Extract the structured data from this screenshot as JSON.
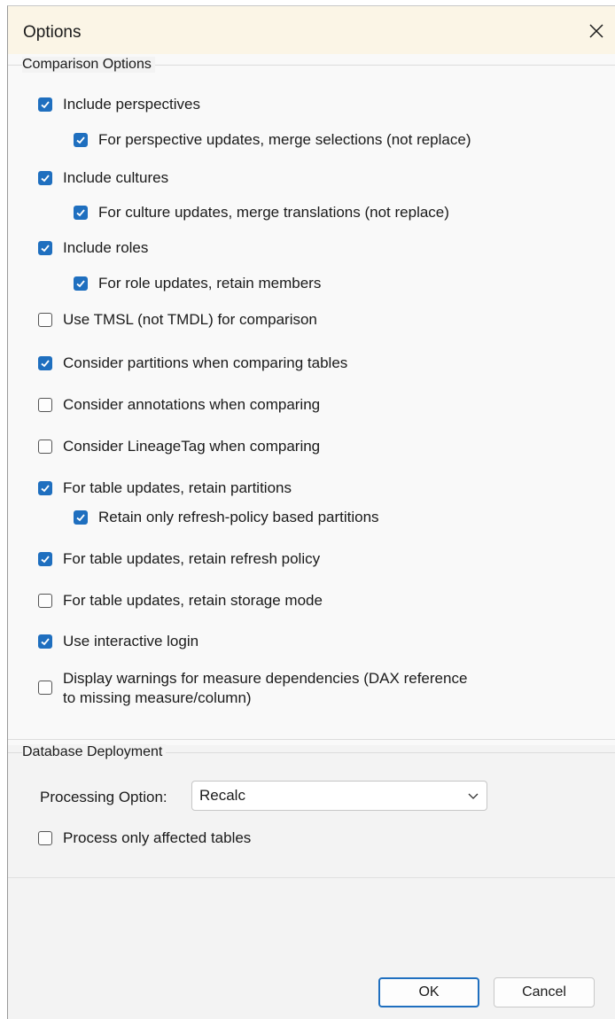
{
  "window": {
    "title": "Options"
  },
  "comparison": {
    "title": "Comparison Options",
    "options": [
      {
        "label": "Include perspectives",
        "checked": true
      },
      {
        "label": "For perspective updates, merge selections (not replace)",
        "checked": true
      },
      {
        "label": "Include cultures",
        "checked": true
      },
      {
        "label": "For culture updates, merge translations (not replace)",
        "checked": true
      },
      {
        "label": "Include roles",
        "checked": true
      },
      {
        "label": "For role updates, retain members",
        "checked": true
      },
      {
        "label": "Use TMSL (not TMDL) for comparison",
        "checked": false
      },
      {
        "label": "Consider partitions when comparing tables",
        "checked": true
      },
      {
        "label": "Consider annotations when comparing",
        "checked": false
      },
      {
        "label": "Consider LineageTag when comparing",
        "checked": false
      },
      {
        "label": "For table updates, retain partitions",
        "checked": true
      },
      {
        "label": "Retain only refresh-policy based partitions",
        "checked": true
      },
      {
        "label": "For table updates, retain refresh policy",
        "checked": true
      },
      {
        "label": "For table updates, retain storage mode",
        "checked": false
      },
      {
        "label": "Use interactive login",
        "checked": true
      },
      {
        "label": "Display warnings for measure dependencies (DAX reference to missing measure/column)",
        "checked": false
      }
    ]
  },
  "deployment": {
    "title": "Database Deployment",
    "processing_label": "Processing Option:",
    "processing_value": "Recalc",
    "process_affected": {
      "label": "Process only affected tables",
      "checked": false
    }
  },
  "buttons": {
    "ok": "OK",
    "cancel": "Cancel"
  },
  "colors": {
    "accent": "#1f6fbf",
    "titlebar": "#fbf5e6"
  },
  "icons": {
    "close": "close-icon",
    "check": "check-icon",
    "dropdown": "chevron-down-icon"
  }
}
